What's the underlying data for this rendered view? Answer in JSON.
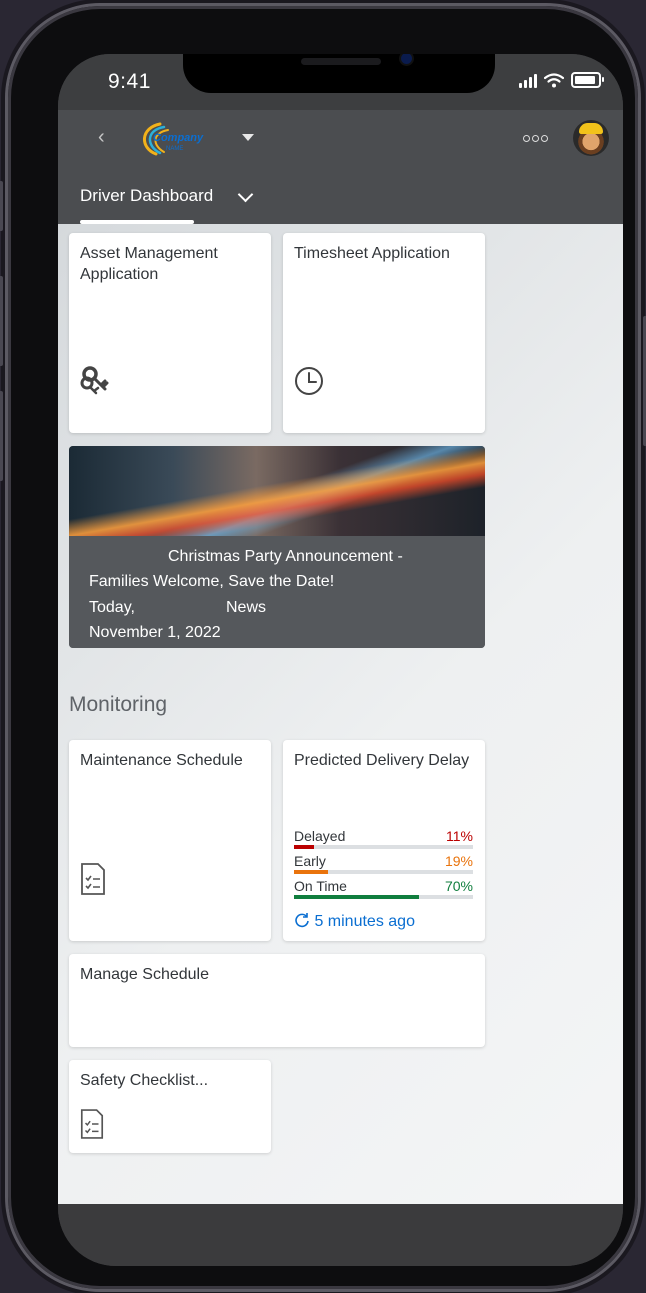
{
  "status": {
    "time": "9:41"
  },
  "shell": {
    "logo_text": "Company",
    "logo_sub": "NAME"
  },
  "page": {
    "title": "Driver Dashboard"
  },
  "tiles": {
    "asset": {
      "title": "Asset Management Application",
      "icon": "keys-icon"
    },
    "timesheet": {
      "title": "Timesheet Application",
      "icon": "clock-icon"
    },
    "maintenance": {
      "title": "Maintenance Schedule",
      "icon": "checklist-icon"
    },
    "manage": {
      "title": "Manage Schedule"
    },
    "safety": {
      "title": "Safety Checklist...",
      "icon": "checklist-icon"
    }
  },
  "news": {
    "headline_line1": "Christmas Party Announcement -",
    "headline_line2": "Families Welcome, Save the Date!",
    "day": "Today,",
    "category": "News",
    "date": "November 1, 2022"
  },
  "monitoring": {
    "section_title": "Monitoring",
    "delay_tile": {
      "title": "Predicted Delivery Delay",
      "items": [
        {
          "label": "Delayed",
          "value": "11%",
          "fraction": 0.11,
          "color": "#bb0000"
        },
        {
          "label": "Early",
          "value": "19%",
          "fraction": 0.19,
          "color": "#e9730c"
        },
        {
          "label": "On Time",
          "value": "70%",
          "fraction": 0.7,
          "color": "#107e3e"
        }
      ],
      "refresh": "5 minutes ago"
    }
  }
}
